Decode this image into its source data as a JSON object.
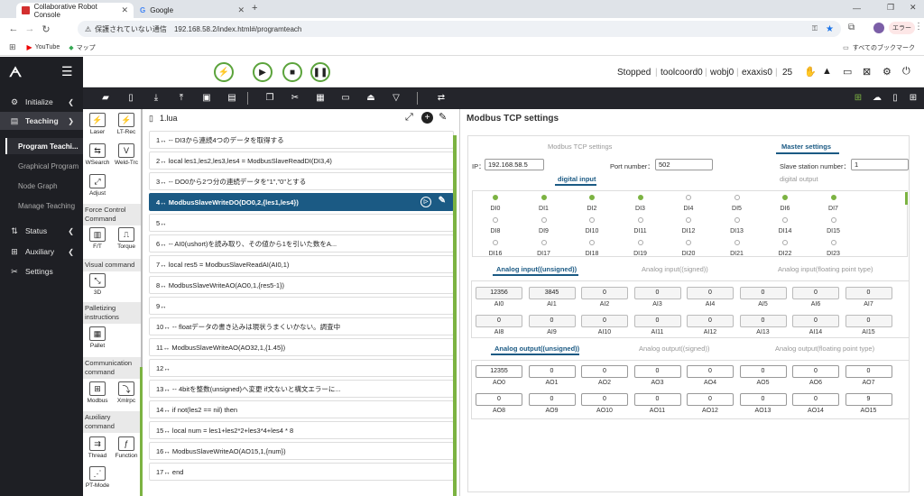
{
  "browser": {
    "tabs": [
      {
        "label": "Collaborative Robot Console",
        "active": true
      },
      {
        "label": "Google",
        "active": false
      }
    ],
    "security_text": "保護されていない通信",
    "url": "192.168.58.2/index.html#/programteach",
    "profile_label": "エラー",
    "bookmarks": [
      "YouTube",
      "マップ"
    ],
    "all_bookmarks_label": "すべてのブックマーク"
  },
  "header": {
    "status": [
      "Stopped",
      "toolcoord0",
      "wobj0",
      "exaxis0",
      "25"
    ]
  },
  "sidebar": {
    "items": [
      {
        "label": "Initialize",
        "icon": "gear-icon"
      },
      {
        "label": "Teaching",
        "icon": "teach-icon"
      },
      {
        "label": "Status",
        "icon": "status-icon"
      },
      {
        "label": "Auxiliary",
        "icon": "grid-icon"
      },
      {
        "label": "Settings",
        "icon": "wrench-icon"
      }
    ],
    "teaching_sub": [
      "Program Teachi...",
      "Graphical Program",
      "Node Graph",
      "Manage Teaching"
    ]
  },
  "palette": {
    "items_top": [
      {
        "label": "Laser",
        "icon": "laser-icon"
      },
      {
        "label": "LT-Rec",
        "icon": "lt-rec-icon"
      },
      {
        "label": "WSearch",
        "icon": "wsearch-icon"
      },
      {
        "label": "Weld-Trc",
        "icon": "weld-trc-icon"
      },
      {
        "label": "Adjust",
        "icon": "adjust-icon"
      }
    ],
    "sections": [
      {
        "title": "Force Control Command",
        "items": [
          {
            "label": "F/T"
          },
          {
            "label": "Torque"
          }
        ]
      },
      {
        "title": "Visual command",
        "items": [
          {
            "label": "3D"
          }
        ]
      },
      {
        "title": "Palletizing instructions",
        "items": [
          {
            "label": "Pallet"
          }
        ]
      },
      {
        "title": "Communication command",
        "items": [
          {
            "label": "Modbus"
          },
          {
            "label": "Xmlrpc"
          }
        ]
      },
      {
        "title": "Auxiliary command",
        "items": [
          {
            "label": "Thread"
          },
          {
            "label": "Function"
          },
          {
            "label": "PT-Mode"
          }
        ]
      }
    ]
  },
  "editor": {
    "filename": "1.lua",
    "lines": [
      "1↔ -- DI3から連続4つのデータを取得する",
      "2↔ local les1,les2,les3,les4 = ModbusSlaveReadDI(DI3,4)",
      "3↔ -- DO0から2つ分の連続データを\"1\",\"0\"とする",
      "4↔ ModbusSlaveWriteDO(DO0,2,{les1,les4})",
      "5↔",
      "6↔ -- AI0(ushort)を読み取り、その値から1を引いた数をA...",
      "7↔ local res5 = ModbusSlaveReadAI(AI0,1)",
      "8↔ ModbusSlaveWriteAO(AO0,1,{res5-1})",
      "9↔",
      "10↔ -- floatデータの書き込みは現状うまくいかない。調査中",
      "11↔ ModbusSlaveWriteAO(AO32,1,{1.45})",
      "12↔",
      "13↔ -- 4bitを整数(unsigned)へ変更 if文ないと構文エラーに...",
      "14↔ if not(les2 == nil) then",
      "15↔ local num = les1+les2*2+les3*4+les4 * 8",
      "16↔ ModbusSlaveWriteAO(AO15,1,{num})",
      "17↔ end"
    ],
    "selected_index": 3
  },
  "modbus": {
    "title": "Modbus TCP settings",
    "tabs": [
      "Modbus TCP settings",
      "Master settings"
    ],
    "ip_label": "IP：",
    "ip": "192.168.58.5",
    "port_label": "Port number：",
    "port": "502",
    "slave_label": "Slave station number：",
    "slave": "1",
    "digital_tabs": [
      "digital input",
      "digital output"
    ],
    "di": [
      {
        "name": "DI0",
        "on": true
      },
      {
        "name": "DI1",
        "on": true
      },
      {
        "name": "DI2",
        "on": true
      },
      {
        "name": "DI3",
        "on": true
      },
      {
        "name": "DI4",
        "on": false
      },
      {
        "name": "DI5",
        "on": false
      },
      {
        "name": "DI6",
        "on": true
      },
      {
        "name": "DI7",
        "on": true
      },
      {
        "name": "DI8",
        "on": false
      },
      {
        "name": "DI9",
        "on": false
      },
      {
        "name": "DI10",
        "on": false
      },
      {
        "name": "DI11",
        "on": false
      },
      {
        "name": "DI12",
        "on": false
      },
      {
        "name": "DI13",
        "on": false
      },
      {
        "name": "DI14",
        "on": false
      },
      {
        "name": "DI15",
        "on": false
      },
      {
        "name": "DI16",
        "on": false
      },
      {
        "name": "DI17",
        "on": false
      },
      {
        "name": "DI18",
        "on": false
      },
      {
        "name": "DI19",
        "on": false
      },
      {
        "name": "DI20",
        "on": false
      },
      {
        "name": "DI21",
        "on": false
      },
      {
        "name": "DI22",
        "on": false
      },
      {
        "name": "DI23",
        "on": false
      }
    ],
    "ai_tabs": [
      "Analog input((unsigned))",
      "Analog input((signed))",
      "Analog input(floating point type)"
    ],
    "ai": [
      {
        "name": "AI0",
        "value": "12356"
      },
      {
        "name": "AI1",
        "value": "3845"
      },
      {
        "name": "AI2",
        "value": "0"
      },
      {
        "name": "AI3",
        "value": "0"
      },
      {
        "name": "AI4",
        "value": "0"
      },
      {
        "name": "AI5",
        "value": "0"
      },
      {
        "name": "AI6",
        "value": "0"
      },
      {
        "name": "AI7",
        "value": "0"
      },
      {
        "name": "AI8",
        "value": "0"
      },
      {
        "name": "AI9",
        "value": "0"
      },
      {
        "name": "AI10",
        "value": "0"
      },
      {
        "name": "AI11",
        "value": "0"
      },
      {
        "name": "AI12",
        "value": "0"
      },
      {
        "name": "AI13",
        "value": "0"
      },
      {
        "name": "AI14",
        "value": "0"
      },
      {
        "name": "AI15",
        "value": "0"
      }
    ],
    "ao_tabs": [
      "Analog output((unsigned))",
      "Analog output((signed))",
      "Analog output(floating point type)"
    ],
    "ao": [
      {
        "name": "AO0",
        "value": "12355"
      },
      {
        "name": "AO1",
        "value": "0"
      },
      {
        "name": "AO2",
        "value": "0"
      },
      {
        "name": "AO3",
        "value": "0"
      },
      {
        "name": "AO4",
        "value": "0"
      },
      {
        "name": "AO5",
        "value": "0"
      },
      {
        "name": "AO6",
        "value": "0"
      },
      {
        "name": "AO7",
        "value": "0"
      },
      {
        "name": "AO8",
        "value": "0"
      },
      {
        "name": "AO9",
        "value": "0"
      },
      {
        "name": "AO10",
        "value": "0"
      },
      {
        "name": "AO11",
        "value": "0"
      },
      {
        "name": "AO12",
        "value": "0"
      },
      {
        "name": "AO13",
        "value": "0"
      },
      {
        "name": "AO14",
        "value": "0"
      },
      {
        "name": "AO15",
        "value": "9"
      }
    ]
  }
}
